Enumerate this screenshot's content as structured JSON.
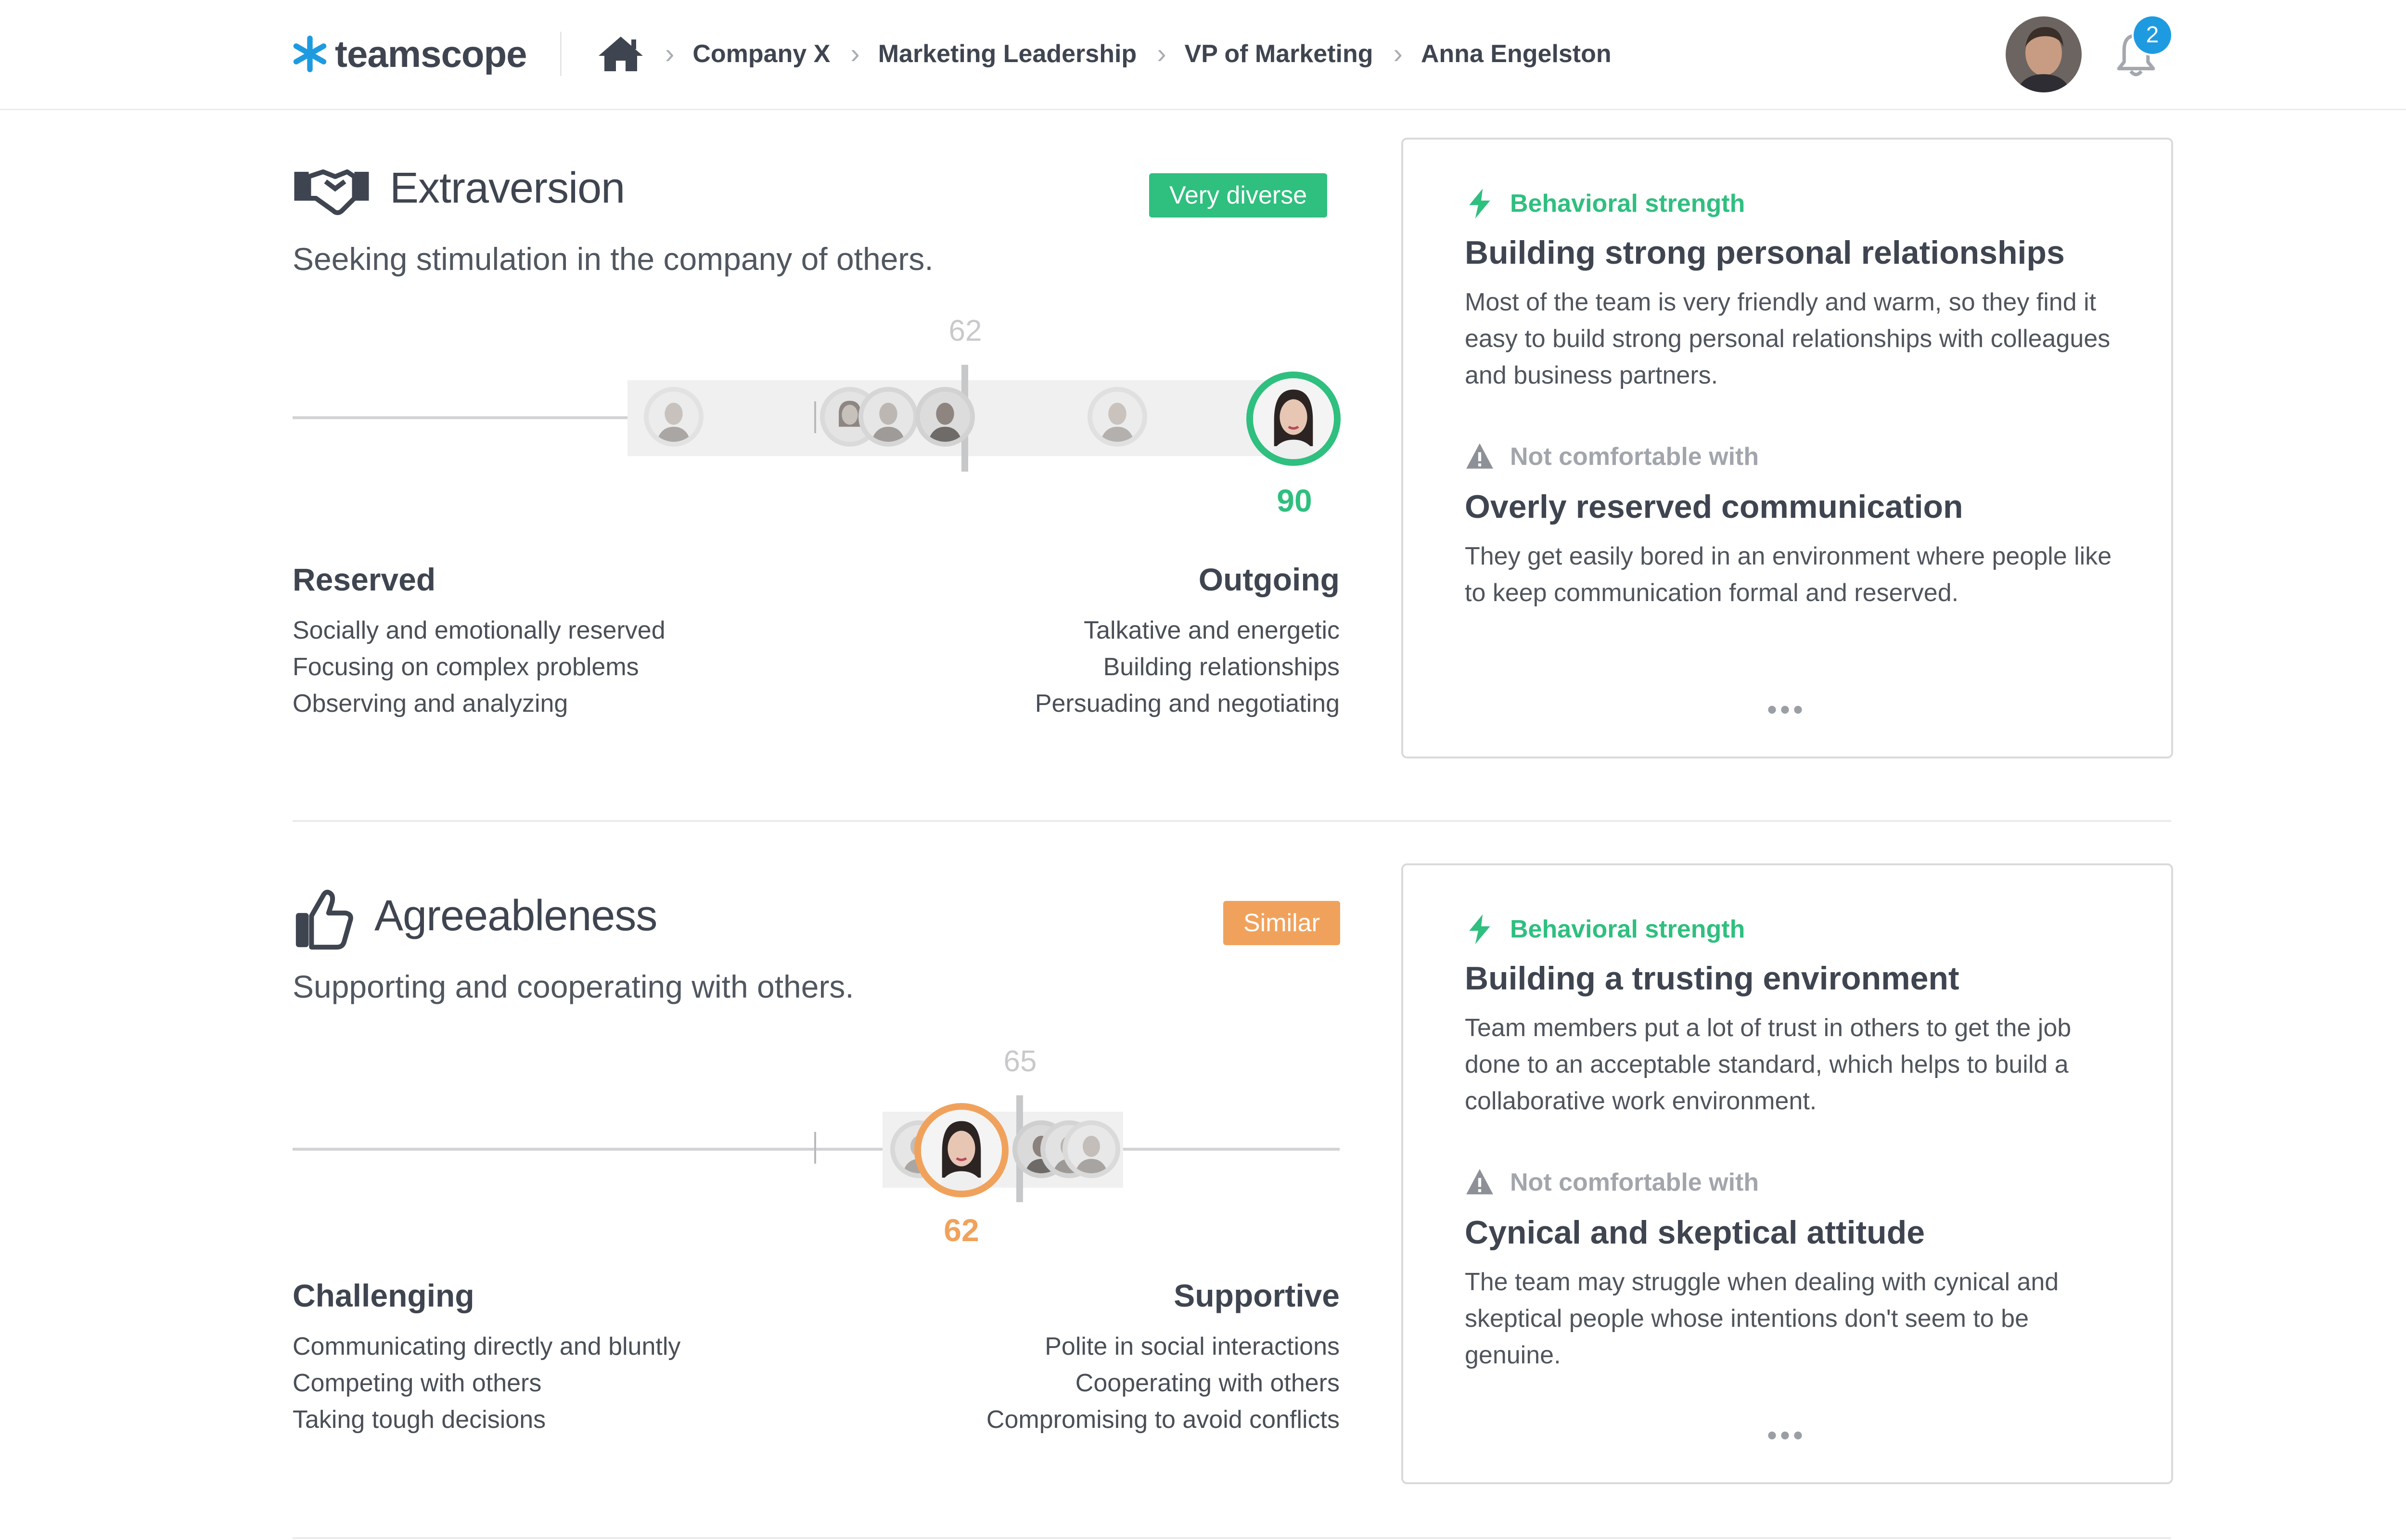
{
  "app": {
    "logo_text": "teamscope"
  },
  "breadcrumbs": [
    "Company X",
    "Marketing Leadership",
    "VP of Marketing",
    "Anna Engelston"
  ],
  "notifications": {
    "count": "2"
  },
  "colors": {
    "green": "#2fbf7f",
    "orange": "#f0a25c",
    "blue": "#1e9be0",
    "text": "#3f4550"
  },
  "sections": [
    {
      "icon": "handshake-icon",
      "title": "Extraversion",
      "subtitle": "Seeking stimulation in the company of others.",
      "tag": "Very diverse",
      "tag_color": "#2fbf7f",
      "team_score": "62",
      "person_score": "90",
      "team_score_value": 62,
      "person_score_value": 90,
      "left_pole": {
        "heading": "Reserved",
        "items": [
          "Socially and emotionally reserved",
          "Focusing on complex problems",
          "Observing and analyzing"
        ]
      },
      "right_pole": {
        "heading": "Outgoing",
        "items": [
          "Talkative and energetic",
          "Building relationships",
          "Persuading and negotiating"
        ]
      },
      "card": {
        "strength_label": "Behavioral strength",
        "strength_title": "Building strong personal relationships",
        "strength_text": "Most of the team is very friendly and warm, so they find it easy to build strong personal relationships with colleagues and business partners.",
        "weak_label": "Not comfortable with",
        "weak_title": "Overly reserved communication",
        "weak_text": "They get easily bored in an environment where people like to keep communication formal and reserved.",
        "more": "•••"
      }
    },
    {
      "icon": "thumbs-up-icon",
      "title": "Agreeableness",
      "subtitle": "Supporting and cooperating with others.",
      "tag": "Similar",
      "tag_color": "#f0a25c",
      "team_score": "65",
      "person_score": "62",
      "team_score_value": 65,
      "person_score_value": 62,
      "left_pole": {
        "heading": "Challenging",
        "items": [
          "Communicating directly and bluntly",
          "Competing with others",
          "Taking tough decisions"
        ]
      },
      "right_pole": {
        "heading": "Supportive",
        "items": [
          "Polite in social interactions",
          "Cooperating with others",
          "Compromising to avoid conflicts"
        ]
      },
      "card": {
        "strength_label": "Behavioral strength",
        "strength_title": "Building a trusting environment",
        "strength_text": "Team members put a lot of trust in others to get the job done to an acceptable standard, which helps to build a collaborative work environment.",
        "weak_label": "Not comfortable with",
        "weak_title": "Cynical and skeptical attitude",
        "weak_text": "The team may struggle when dealing with cynical and skeptical people whose intentions don't seem to be genuine.",
        "more": "•••"
      }
    }
  ]
}
